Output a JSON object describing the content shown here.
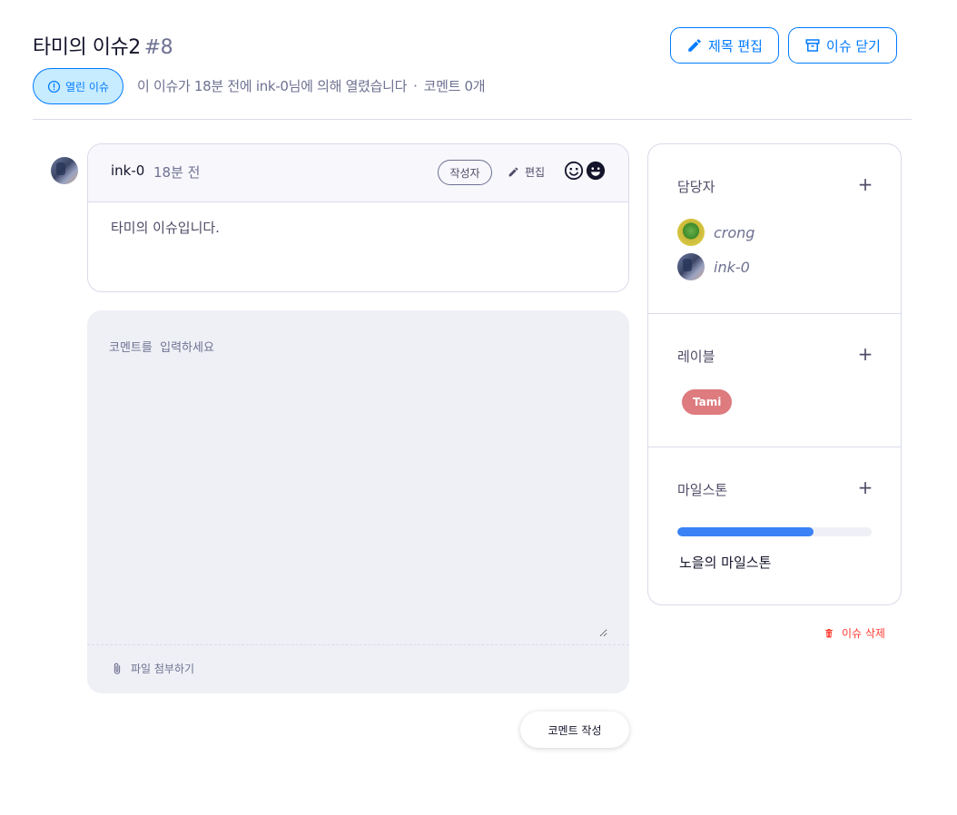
{
  "issue": {
    "title": "타미의 이슈2",
    "number": "#8",
    "status_label": "열린 이슈",
    "meta_text": "이 이슈가 18분 전에 ink-0님에 의해 열렸습니다",
    "meta_sep": "·",
    "comment_count": "코멘트 0개"
  },
  "header": {
    "edit_title_label": "제목 편집",
    "close_issue_label": "이슈 닫기"
  },
  "comment": {
    "author": "ink-0",
    "time": "18분 전",
    "author_tag": "작성자",
    "edit_label": "편집",
    "body": "타미의 이슈입니다.",
    "emojis": [
      "smile-emoji-icon",
      "grin-emoji-icon"
    ]
  },
  "compose": {
    "placeholder": "코멘트를  입력하세요",
    "attach_label": "파일 첨부하기",
    "submit_label": "코멘트 작성"
  },
  "sidebar": {
    "assignees_title": "담당자",
    "assignees": [
      {
        "name": "crong"
      },
      {
        "name": "ink-0"
      }
    ],
    "labels_title": "레이블",
    "labels": [
      {
        "name": "Tami",
        "color": "#dd7b7f"
      }
    ],
    "milestone_title": "마일스톤",
    "milestone_name": "노을의 마일스톤",
    "milestone_progress": 0.7,
    "plus": "+",
    "delete_label": "이슈 삭제"
  },
  "colors": {
    "primary": "#007aff",
    "badge_bg": "#c7ebff",
    "progress": "#3b82f6",
    "danger": "#ff3b30"
  }
}
